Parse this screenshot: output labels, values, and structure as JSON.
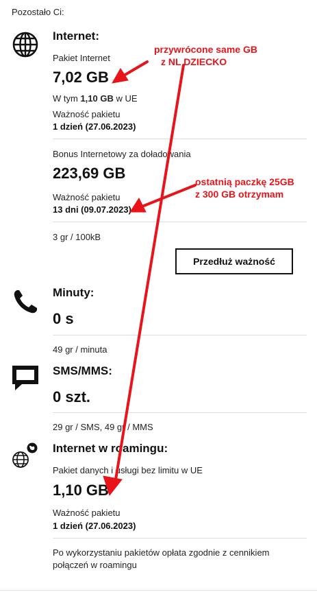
{
  "header": {
    "remaining_label": "Pozostało Ci:"
  },
  "internet": {
    "title": "Internet:",
    "package_label": "Pakiet Internet",
    "package_amount": "7,02 GB",
    "eu_prefix": "W tym ",
    "eu_amount": "1,10 GB",
    "eu_suffix": " w UE",
    "validity_label": "Ważność pakietu",
    "validity_value": "1 dzień (27.06.2023)",
    "bonus_label": "Bonus Internetowy za doładowania",
    "bonus_amount": "223,69 GB",
    "bonus_validity_label": "Ważność pakietu",
    "bonus_validity_value": "13 dni (09.07.2023)",
    "rate": "3 gr / 100kB",
    "extend_button": "Przedłuż ważność"
  },
  "minutes": {
    "title": "Minuty:",
    "amount": "0 s",
    "rate": "49 gr / minuta"
  },
  "sms": {
    "title": "SMS/MMS:",
    "amount": "0 szt.",
    "rate": "29 gr / SMS, 49 gr / MMS"
  },
  "roaming": {
    "title": "Internet w roamingu:",
    "package_label": "Pakiet danych i usługi bez limitu w UE",
    "amount": "1,10 GB",
    "validity_label": "Ważność pakietu",
    "validity_value": "1 dzień (27.06.2023)",
    "note": "Po wykorzystaniu pakietów opłata zgodnie z cennikiem połączeń w roamingu"
  },
  "annotations": {
    "note1_line1": "przywrócone same GB",
    "note1_line2": "z NL DZIECKO",
    "note2_line1": "ostatnią paczkę 25GB",
    "note2_line2": "z 300 GB otrzymam",
    "color": "#e8141a"
  },
  "icons": {
    "internet": "globe-icon",
    "minutes": "phone-icon",
    "sms": "chat-bubble-icon",
    "roaming": "globe-roaming-icon"
  }
}
